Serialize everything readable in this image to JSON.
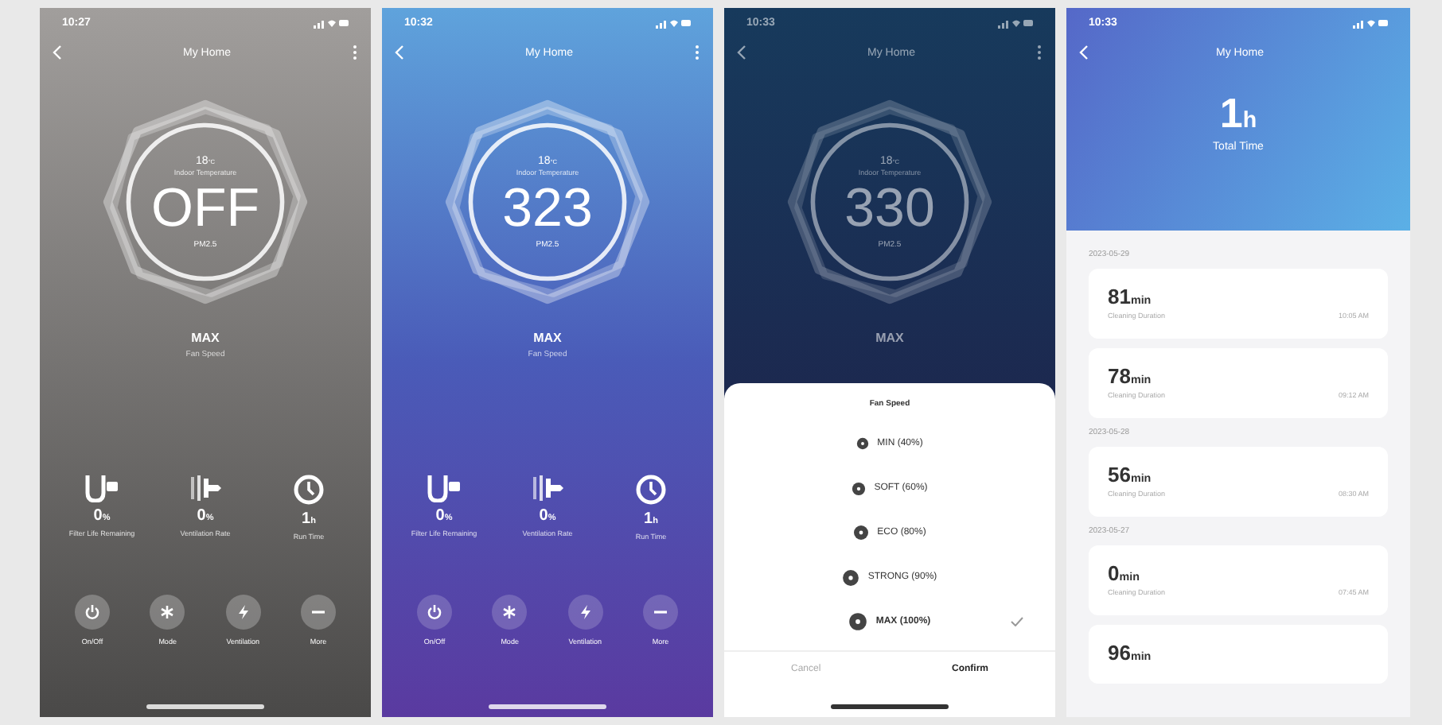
{
  "screens": [
    {
      "kind": "device",
      "power_on": false,
      "dimmed": false,
      "status_time": "10:27",
      "title": "My Home",
      "dial": {
        "top_value": "18",
        "top_unit": "°C",
        "top_label": "Indoor Temperature",
        "value": "OFF",
        "unit": "PM2.5"
      },
      "mode": "MAX",
      "mode_label": "Fan Speed",
      "stats": [
        {
          "kind": "filter",
          "value": "0",
          "unit": "%",
          "label": "Filter Life Remaining"
        },
        {
          "kind": "ion",
          "value": "0",
          "unit": "%",
          "label": "Ventilation Rate"
        },
        {
          "kind": "clock",
          "value": "1",
          "unit": "h",
          "label": "Run Time"
        }
      ],
      "actions": [
        {
          "kind": "power",
          "label": "On/Off"
        },
        {
          "kind": "mode",
          "label": "Mode"
        },
        {
          "kind": "bolt",
          "label": "Ventilation"
        },
        {
          "kind": "more",
          "label": "More"
        }
      ]
    },
    {
      "kind": "device",
      "power_on": true,
      "dimmed": false,
      "status_time": "10:32",
      "title": "My Home",
      "dial": {
        "top_value": "18",
        "top_unit": "°C",
        "top_label": "Indoor Temperature",
        "value": "323",
        "unit": "PM2.5"
      },
      "mode": "MAX",
      "mode_label": "Fan Speed",
      "stats": [
        {
          "kind": "filter",
          "value": "0",
          "unit": "%",
          "label": "Filter Life Remaining"
        },
        {
          "kind": "ion",
          "value": "0",
          "unit": "%",
          "label": "Ventilation Rate"
        },
        {
          "kind": "clock",
          "value": "1",
          "unit": "h",
          "label": "Run Time"
        }
      ],
      "actions": [
        {
          "kind": "power",
          "label": "On/Off"
        },
        {
          "kind": "mode",
          "label": "Mode"
        },
        {
          "kind": "bolt",
          "label": "Ventilation"
        },
        {
          "kind": "more",
          "label": "More"
        }
      ]
    },
    {
      "kind": "device",
      "power_on": true,
      "dimmed": true,
      "status_time": "10:33",
      "title": "My Home",
      "dial": {
        "top_value": "18",
        "top_unit": "°C",
        "top_label": "Indoor Temperature",
        "value": "330",
        "unit": "PM2.5"
      },
      "mode": "MAX",
      "sheet": {
        "title": "Fan Speed",
        "options": [
          {
            "label": "MIN (40%)",
            "selected": false
          },
          {
            "label": "SOFT (60%)",
            "selected": false
          },
          {
            "label": "ECO (80%)",
            "selected": false
          },
          {
            "label": "STRONG (90%)",
            "selected": false
          },
          {
            "label": "MAX (100%)",
            "selected": true
          }
        ],
        "cancel": "Cancel",
        "confirm": "Confirm"
      }
    },
    {
      "kind": "stats",
      "status_time": "10:33",
      "title": "My Home",
      "total": {
        "value": "1",
        "unit": "h",
        "label": "Total Time"
      },
      "groups": [
        {
          "date": "2023-05-29",
          "cards": [
            {
              "value": "81",
              "unit": "min",
              "label": "Cleaning Duration",
              "time": "10:05 AM"
            },
            {
              "value": "78",
              "unit": "min",
              "label": "Cleaning Duration",
              "time": "09:12 AM"
            }
          ]
        },
        {
          "date": "2023-05-28",
          "cards": [
            {
              "value": "56",
              "unit": "min",
              "label": "Cleaning Duration",
              "time": "08:30 AM"
            }
          ]
        },
        {
          "date": "2023-05-27",
          "cards": [
            {
              "value": "0",
              "unit": "min",
              "label": "Cleaning Duration",
              "time": "07:45 AM"
            },
            {
              "value": "96",
              "unit": "min"
            }
          ]
        }
      ]
    }
  ]
}
